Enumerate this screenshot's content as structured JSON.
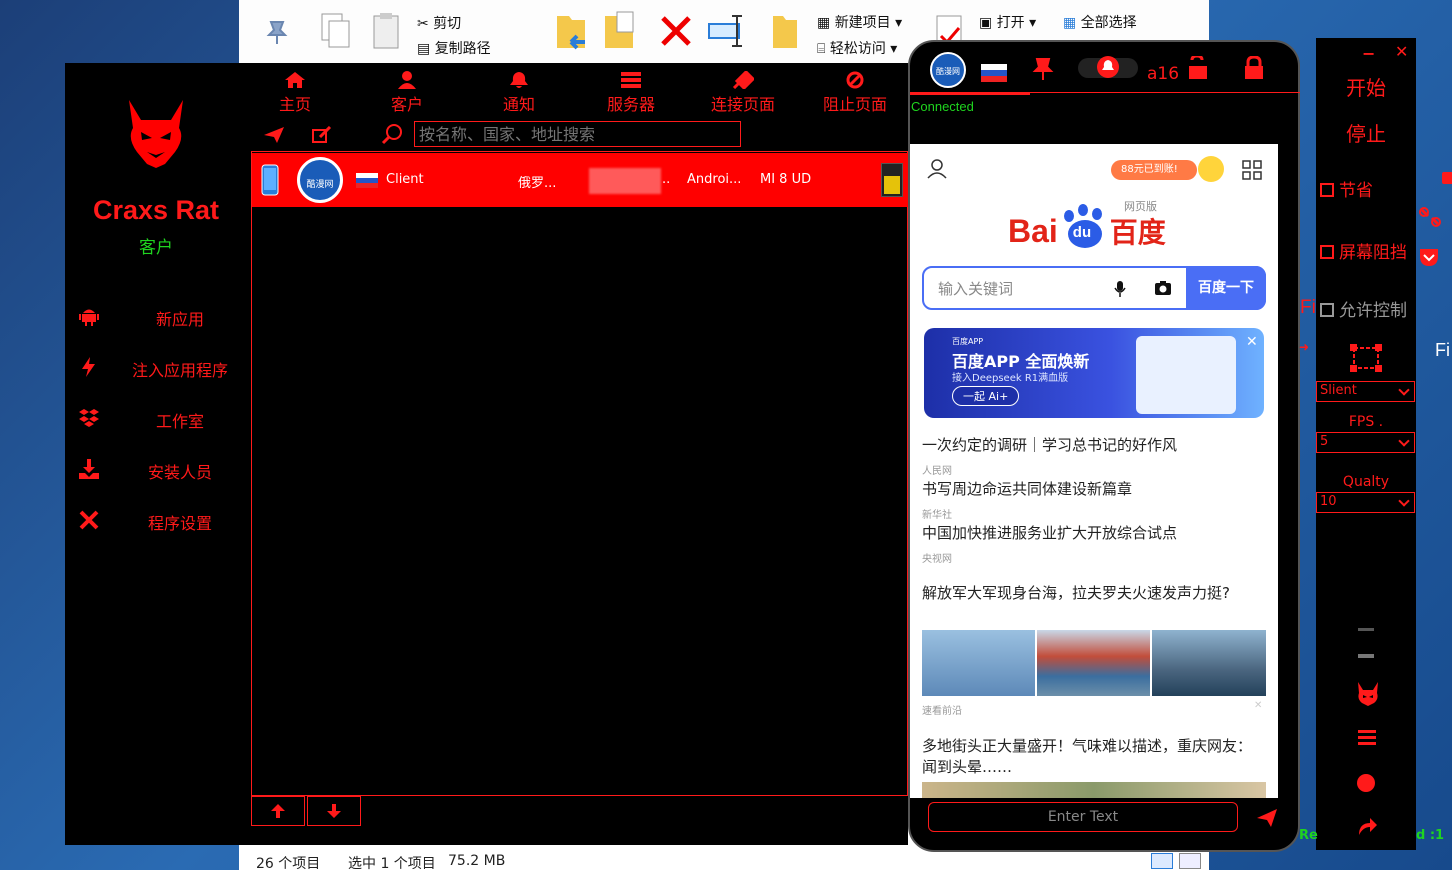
{
  "explorer": {
    "cut_label": "剪切",
    "copy_path_label": "复制路径",
    "new_item_label": "新建项目",
    "easy_access_label": "轻松访问",
    "open_label": "打开",
    "select_all_label": "全部选择",
    "status_items": "26 个项目",
    "status_selected": "选中 1 个项目",
    "status_size": "75.2 MB"
  },
  "rat": {
    "brand": "Craxs Rat",
    "brand_sub": "客户",
    "sidebar": [
      {
        "label": "新应用",
        "icon": "android-icon"
      },
      {
        "label": "注入应用程序",
        "icon": "bolt-icon"
      },
      {
        "label": "工作室",
        "icon": "dropbox-icon"
      },
      {
        "label": "安装人员",
        "icon": "download-icon"
      },
      {
        "label": "程序设置",
        "icon": "tools-icon"
      }
    ],
    "topnav": [
      {
        "label": "主页",
        "icon": "home-icon"
      },
      {
        "label": "客户",
        "icon": "user-icon"
      },
      {
        "label": "通知",
        "icon": "bell-icon"
      },
      {
        "label": "服务器",
        "icon": "server-icon"
      },
      {
        "label": "连接页面",
        "icon": "plug-icon"
      },
      {
        "label": "阻止页面",
        "icon": "block-icon"
      }
    ],
    "search_placeholder": "按名称、国家、地址搜索",
    "client": {
      "badge": "酷漫网",
      "name": "Client",
      "country": "俄罗...",
      "ip_suffix": "..",
      "os": "Androi...",
      "model": "MI 8 UD"
    }
  },
  "phone": {
    "badge": "酷漫网",
    "device_name": "a16",
    "status": "Connected",
    "input_placeholder": "Enter Text",
    "screen": {
      "promo": "88元已到账!",
      "baidu_sub": "网页版",
      "search_placeholder": "输入关键词",
      "search_button": "百度一下",
      "banner_tag": "百度APP",
      "banner_title": "百度APP 全面焕新",
      "banner_sub": "接入Deepseek R1满血版",
      "banner_cta": "一起 Ai+",
      "news": [
        {
          "title": "一次约定的调研｜学习总书记的好作风",
          "source": "人民网"
        },
        {
          "title": "书写周边命运共同体建设新篇章",
          "source": "新华社"
        },
        {
          "title": "中国加快推进服务业扩大开放综合试点",
          "source": "央视网"
        },
        {
          "title": "解放军大军现身台海，拉夫罗夫火速发声力挺?",
          "source": "速看前沿"
        },
        {
          "title": "多地街头正大量盛开！气味难以描述，重庆网友：闻到头晕……",
          "source": ""
        }
      ]
    }
  },
  "panel": {
    "start": "开始",
    "stop": "停止",
    "save_label": "节省",
    "screen_block_label": "屏幕阻挡",
    "allow_control_label": "允许控制",
    "mode_value": "Slient",
    "fps_label": "FPS .",
    "fps_value": "5",
    "quality_label": "Qualty",
    "quality_value": "10",
    "edge_fi_left": "Fi",
    "edge_fi_right": "Fi",
    "edge_re": "Re",
    "edge_d1": "d :1"
  },
  "colors": {
    "accent": "#ff1a1a",
    "connected": "#1fd41f",
    "baidu_blue": "#3266f5"
  }
}
